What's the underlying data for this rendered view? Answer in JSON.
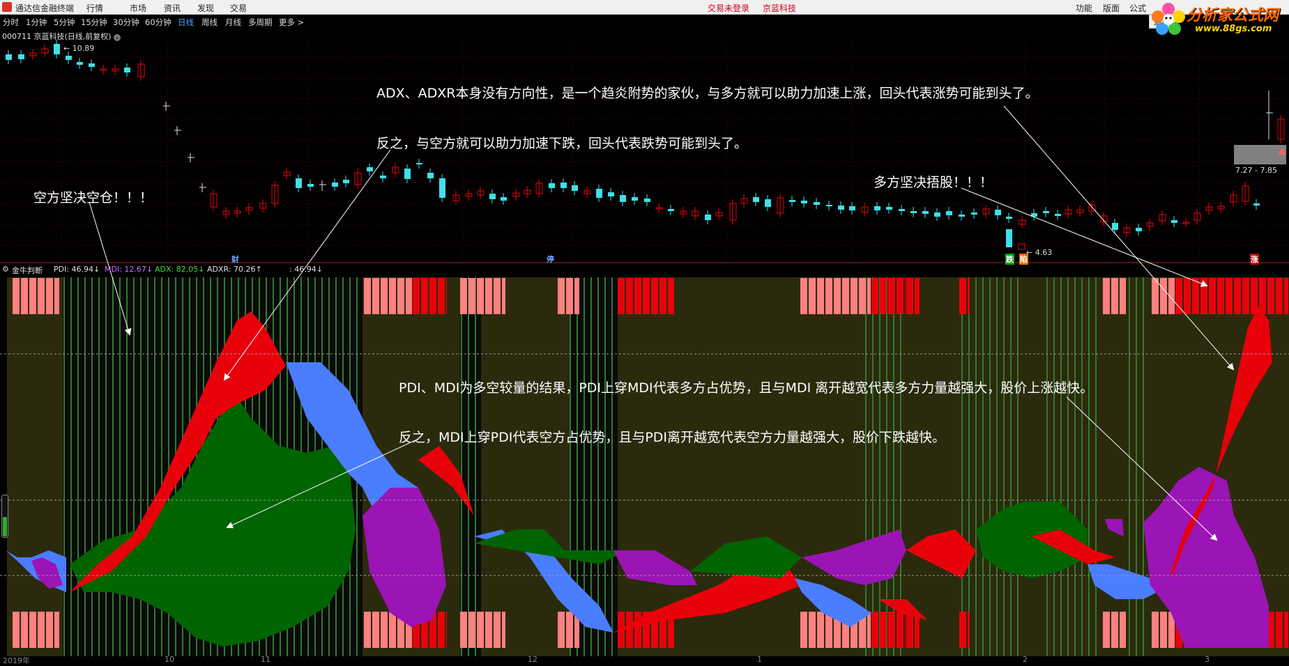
{
  "app": {
    "title": "通达信金融终端",
    "menu": [
      "行情",
      "市场",
      "资讯",
      "发现",
      "交易"
    ],
    "login_status": "交易未登录",
    "company": "京蓝科技",
    "right_menu": [
      "功能",
      "版面",
      "公式"
    ]
  },
  "branding": {
    "name": "分析家公式网",
    "url": "www.88gs.com"
  },
  "toolbar": {
    "periods": [
      "分时",
      "1分钟",
      "5分钟",
      "15分钟",
      "30分钟",
      "60分钟",
      "日线",
      "周线",
      "月线",
      "多周期",
      "更多 >"
    ],
    "active_period": "日线",
    "fuquan": "复权"
  },
  "stock": {
    "title": "000711 京蓝科技(日线,前复权)"
  },
  "price": {
    "high_label": "10.89",
    "low_label": "4.63",
    "range_label": "7.27 - 7.85"
  },
  "markers": [
    "财",
    "停",
    "跌",
    "陷",
    "涨"
  ],
  "indicator": {
    "name": "金牛判断",
    "pdi": "PDI: 46.94↓",
    "mdi": "MDI: 12.67↓",
    "adx": "ADX: 82.05↓",
    "adxr": "ADXR: 70.26↑",
    "extra": ": 46.94↓"
  },
  "annotations": {
    "adx_up": "ADX、ADXR本身没有方向性，是一个趋炎附势的家伙，与多方就可以助力加速上涨，回头代表涨势可能到头了。",
    "adx_down": "反之，与空方就可以助力加速下跌，回头代表跌势可能到头了。",
    "bear": "空方坚决空仓！！！",
    "bull": "多方坚决捂股！！！",
    "pdi_up": "PDI、MDI为多空较量的结果，PDI上穿MDI代表多方占优势，且与MDI 离开越宽代表多方力量越强大，股价上涨越快。",
    "mdi_up": "反之，MDI上穿PDI代表空方占优势，且与PDI离开越宽代表空方力量越强大，股价下跌越快。"
  },
  "date_axis": [
    "2019年",
    "10",
    "11",
    "12",
    "1",
    "2",
    "3"
  ],
  "colors": {
    "red": "#e8000b",
    "pink": "#ff8080",
    "blue": "#4a7dff",
    "green": "#006400",
    "purple": "#9b14b5",
    "olive": "#2c2a0c",
    "cyan": "#3fe0e8"
  }
}
